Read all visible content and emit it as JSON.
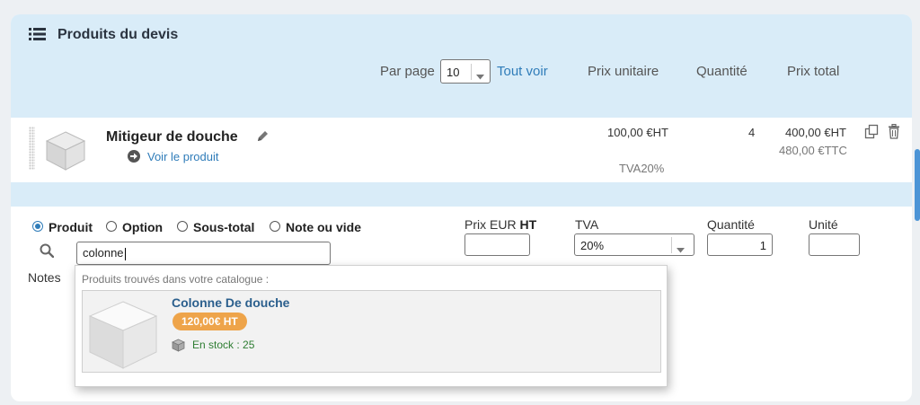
{
  "header": {
    "title": "Produits du devis",
    "per_page_label": "Par page",
    "per_page_value": "10",
    "see_all": "Tout voir",
    "columns": {
      "unit_price": "Prix unitaire",
      "quantity": "Quantité",
      "total_price": "Prix total"
    }
  },
  "product": {
    "name": "Mitigeur de douche",
    "view_link": "Voir le produit",
    "unit_price": "100,00 €HT",
    "vat": "TVA20%",
    "quantity": "4",
    "total_ht": "400,00 €HT",
    "total_ttc": "480,00 €TTC"
  },
  "form": {
    "types": [
      {
        "label": "Produit",
        "selected": true
      },
      {
        "label": "Option",
        "selected": false
      },
      {
        "label": "Sous-total",
        "selected": false
      },
      {
        "label": "Note ou vide",
        "selected": false
      }
    ],
    "search_value": "colonne",
    "notes_label": "Notes",
    "price_label_prefix": "Prix EUR ",
    "price_label_bold": "HT",
    "price_value": "",
    "vat_label": "TVA",
    "vat_value": "20%",
    "qty_label": "Quantité",
    "qty_value": "1",
    "unit_label": "Unité",
    "unit_value": ""
  },
  "dropdown": {
    "header": "Produits trouvés dans votre catalogue :",
    "results": [
      {
        "name": "Colonne De douche",
        "price": "120,00€ HT",
        "stock": "En stock : 25"
      }
    ]
  },
  "colors": {
    "header_bg": "#d9ecf8",
    "link": "#2f7cb9",
    "price_badge": "#eea44a",
    "stock_green": "#2e7d32"
  }
}
